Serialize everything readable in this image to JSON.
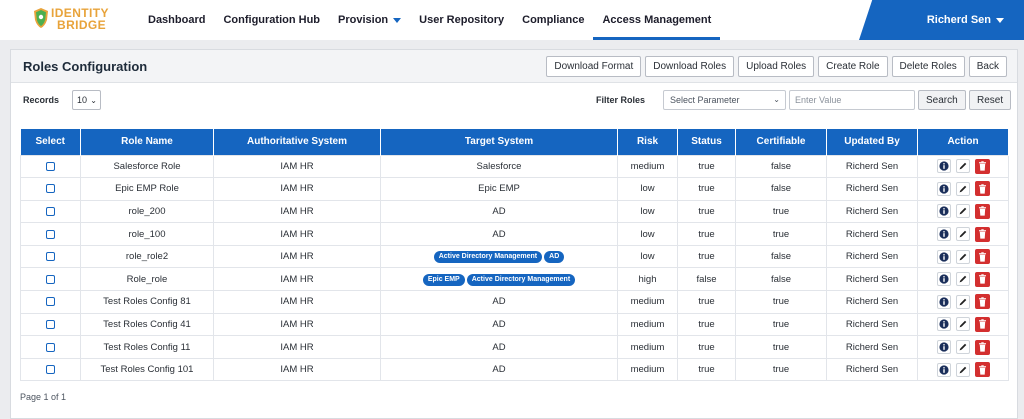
{
  "brand": {
    "line1": "IDENTITY",
    "line2": "BRIDGE"
  },
  "nav": {
    "items": [
      {
        "label": "Dashboard"
      },
      {
        "label": "Configuration Hub"
      },
      {
        "label": "Provision"
      },
      {
        "label": "User Repository"
      },
      {
        "label": "Compliance"
      },
      {
        "label": "Access Management"
      }
    ],
    "user": "Richerd Sen"
  },
  "page": {
    "title": "Roles Configuration",
    "buttons": {
      "download_format": "Download Format",
      "download_roles": "Download Roles",
      "upload_roles": "Upload Roles",
      "create_role": "Create Role",
      "delete_roles": "Delete Roles",
      "back": "Back"
    },
    "records_label": "Records",
    "records_value": "10",
    "filter_label": "Filter Roles",
    "param_value": "Select Parameter",
    "value_placeholder": "Enter Value",
    "search_label": "Search",
    "reset_label": "Reset",
    "pagination": "Page 1 of 1"
  },
  "table": {
    "headers": [
      "Select",
      "Role Name",
      "Authoritative System",
      "Target System",
      "Risk",
      "Status",
      "Certifiable",
      "Updated By",
      "Action"
    ],
    "rows": [
      {
        "role": "Salesforce Role",
        "auth": "IAM HR",
        "target": [
          "Salesforce"
        ],
        "target_pills": false,
        "risk": "medium",
        "status": "true",
        "cert": "false",
        "by": "Richerd Sen"
      },
      {
        "role": "Epic EMP Role",
        "auth": "IAM HR",
        "target": [
          "Epic EMP"
        ],
        "target_pills": false,
        "risk": "low",
        "status": "true",
        "cert": "false",
        "by": "Richerd Sen"
      },
      {
        "role": "role_200",
        "auth": "IAM HR",
        "target": [
          "AD"
        ],
        "target_pills": false,
        "risk": "low",
        "status": "true",
        "cert": "true",
        "by": "Richerd Sen"
      },
      {
        "role": "role_100",
        "auth": "IAM HR",
        "target": [
          "AD"
        ],
        "target_pills": false,
        "risk": "low",
        "status": "true",
        "cert": "true",
        "by": "Richerd Sen"
      },
      {
        "role": "role_role2",
        "auth": "IAM HR",
        "target": [
          "Active Directory Management",
          "AD"
        ],
        "target_pills": true,
        "risk": "low",
        "status": "true",
        "cert": "false",
        "by": "Richerd Sen"
      },
      {
        "role": "Role_role",
        "auth": "IAM HR",
        "target": [
          "Epic EMP",
          "Active Directory Management"
        ],
        "target_pills": true,
        "risk": "high",
        "status": "false",
        "cert": "false",
        "by": "Richerd Sen"
      },
      {
        "role": "Test Roles Config 81",
        "auth": "IAM HR",
        "target": [
          "AD"
        ],
        "target_pills": false,
        "risk": "medium",
        "status": "true",
        "cert": "true",
        "by": "Richerd Sen"
      },
      {
        "role": "Test Roles Config 41",
        "auth": "IAM HR",
        "target": [
          "AD"
        ],
        "target_pills": false,
        "risk": "medium",
        "status": "true",
        "cert": "true",
        "by": "Richerd Sen"
      },
      {
        "role": "Test Roles Config 11",
        "auth": "IAM HR",
        "target": [
          "AD"
        ],
        "target_pills": false,
        "risk": "medium",
        "status": "true",
        "cert": "true",
        "by": "Richerd Sen"
      },
      {
        "role": "Test Roles Config 101",
        "auth": "IAM HR",
        "target": [
          "AD"
        ],
        "target_pills": false,
        "risk": "medium",
        "status": "true",
        "cert": "true",
        "by": "Richerd Sen"
      }
    ]
  },
  "colors": {
    "accent": "#1565c0",
    "danger": "#d32f2f",
    "brand": "#e8a33a"
  }
}
